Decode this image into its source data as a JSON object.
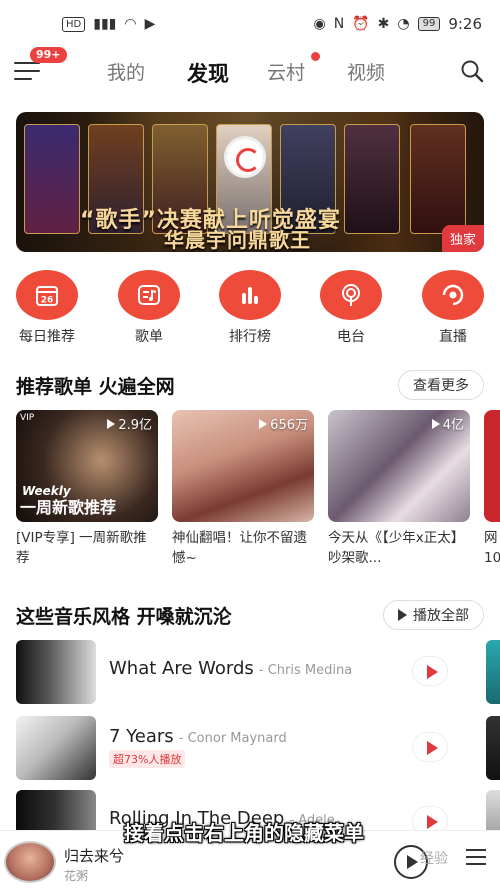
{
  "status_bar": {
    "left": [
      "HD",
      "4G",
      "Wi-Fi",
      "video"
    ],
    "battery": "99",
    "time": "9:26"
  },
  "topnav": {
    "badge": "99+",
    "tabs": [
      {
        "label": "我的"
      },
      {
        "label": "发现"
      },
      {
        "label": "云村"
      },
      {
        "label": "视频"
      }
    ],
    "active_tab": "发现"
  },
  "banner": {
    "line1": "“歌手”决赛献上听觉盛宴",
    "line2": "华晨宇问鼎歌王",
    "tag": "独家"
  },
  "quick_entries": [
    {
      "label": "每日推荐",
      "icon": "calendar-icon",
      "number": "26"
    },
    {
      "label": "歌单",
      "icon": "playlist-icon"
    },
    {
      "label": "排行榜",
      "icon": "bar-chart-icon"
    },
    {
      "label": "电台",
      "icon": "radio-icon"
    },
    {
      "label": "直播",
      "icon": "live-icon"
    }
  ],
  "recommend": {
    "title": "推荐歌单 火遍全网",
    "more": "查看更多",
    "items": [
      {
        "count": "2.9亿",
        "title": "[VIP专享] 一周新歌推荐",
        "vip": "VIP",
        "overlay_a": "Weekly",
        "overlay_b": "一周新歌推荐"
      },
      {
        "count": "656万",
        "title": "神仙翻唱！让你不留遗憾~"
      },
      {
        "count": "4亿",
        "title": "今天从《【少年x正太】吵架歌..."
      }
    ],
    "partial_title": "网10"
  },
  "styles": {
    "title": "这些音乐风格 开嗓就沉沦",
    "play_all": "播放全部",
    "songs": [
      {
        "name": "What Are Words",
        "artist": "- Chris Medina",
        "tag": ""
      },
      {
        "name": "7 Years",
        "artist": "- Conor Maynard",
        "tag": "超73%人播放"
      },
      {
        "name": "Rolling In The Deep",
        "artist": "- Adele",
        "tag": ""
      }
    ]
  },
  "player": {
    "song": "归去来兮",
    "artist": "花粥"
  },
  "subtitle": "接着点击右上角的隐藏菜单",
  "watermark": "经验"
}
